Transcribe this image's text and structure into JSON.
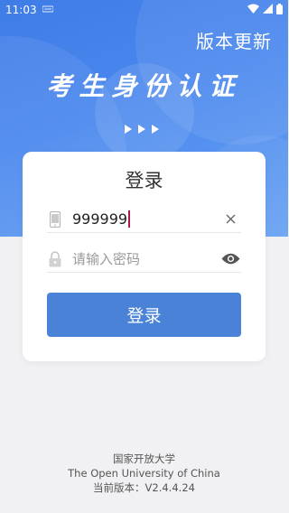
{
  "status_bar": {
    "time": "11:03",
    "icons": [
      "notification-icon",
      "wifi-icon",
      "signal-icon",
      "battery-icon"
    ]
  },
  "header": {
    "version_update": "版本更新",
    "title": "考生身份认证"
  },
  "login_card": {
    "title": "登录",
    "phone_value": "999999",
    "password_placeholder": "请输入密码",
    "login_button": "登录"
  },
  "footer": {
    "university_cn": "国家开放大学",
    "university_en": "The Open University of China",
    "version": "当前版本：V2.4.4.24"
  },
  "colors": {
    "hero_blue": "#4a88ee",
    "button_blue": "#4a82d8",
    "background": "#f1f1f3"
  }
}
